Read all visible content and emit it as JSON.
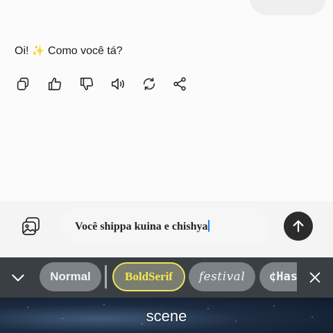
{
  "message": {
    "text_before": "Oi! ",
    "sparkle": "✨",
    "text_after": " Como você tá?"
  },
  "actions": [
    {
      "icon": "copy-icon"
    },
    {
      "icon": "thumbs-up-icon"
    },
    {
      "icon": "thumbs-down-icon"
    },
    {
      "icon": "speaker-icon"
    },
    {
      "icon": "regenerate-icon"
    },
    {
      "icon": "share-icon"
    }
  ],
  "composer": {
    "attach_icon": "image-attach-icon",
    "input_value": "Você shippa kuina e chishya",
    "send_icon": "arrow-up-icon"
  },
  "font_bar": {
    "collapse_icon": "chevron-down-icon",
    "chips": [
      "Normal",
      "BoldSerif",
      "festival",
      "¢Has"
    ],
    "selected_chip": "BoldSerif",
    "close_icon": "close-icon"
  },
  "scene": {
    "label": "scene"
  },
  "colors": {
    "accent_yellow": "#f1e25a",
    "send_button": "#2b2b2b",
    "font_bar_bg": "#3a3f44",
    "caret": "#1e7cf0"
  }
}
